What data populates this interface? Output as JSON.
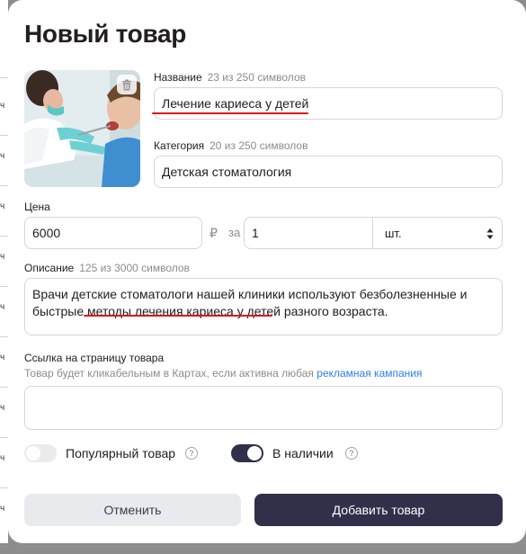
{
  "dialog": {
    "title": "Новый товар"
  },
  "background": {
    "ch": "ч"
  },
  "name_field": {
    "label": "Название",
    "counter": "23 из 250 символов",
    "value": "Лечение кариеса у детей"
  },
  "category_field": {
    "label": "Категория",
    "counter": "20 из 250 символов",
    "value": "Детская стоматология"
  },
  "price_field": {
    "label": "Цена",
    "value": "6000",
    "currency": "₽",
    "per_label": "за",
    "quantity": "1",
    "unit": "шт."
  },
  "description_field": {
    "label": "Описание",
    "counter": "125 из 3000 символов",
    "text_line1": "Врачи детские стоматологи нашей клиники используют безболезненные  и",
    "text_line2_before": "быстрые ",
    "text_line2_highlight": "методы лечения кариеса у детей",
    "text_line2_after": " разного возраста."
  },
  "link_field": {
    "label": "Ссылка на страницу товара",
    "hint_prefix": "Товар будет кликабельным в Картах, если активна любая ",
    "hint_link": "рекламная кампания",
    "value": ""
  },
  "toggles": {
    "popular": {
      "label": "Популярный товар",
      "on": false,
      "help": "?"
    },
    "in_stock": {
      "label": "В наличии",
      "on": true,
      "help": "?"
    }
  },
  "buttons": {
    "cancel": "Отменить",
    "add": "Добавить товар"
  },
  "colors": {
    "accent_dark": "#31304a",
    "highlight_red": "#e0141c",
    "link_blue": "#2a7ff0"
  },
  "icons": {
    "photo_delete": "trash-icon",
    "unit_select": "updown-arrows-icon",
    "help": "question-circle-icon"
  }
}
